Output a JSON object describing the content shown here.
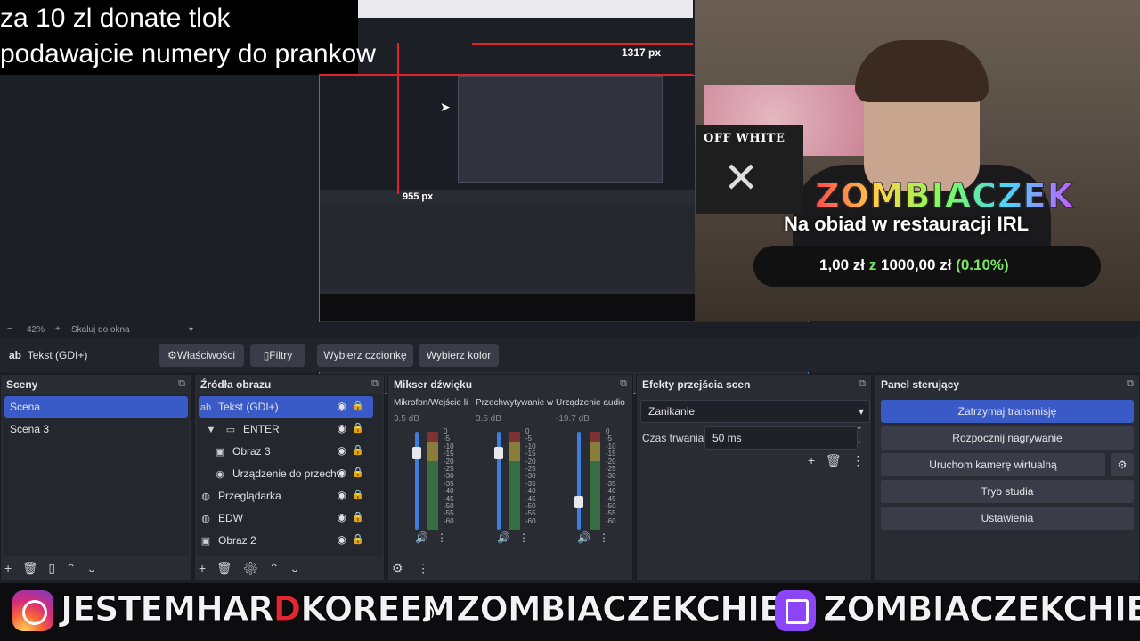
{
  "overlay": {
    "donate_line1": "za 10 zl donate tlok",
    "donate_line2": "podawajcie numery do prankow"
  },
  "preview": {
    "px_label_top": "1317 px",
    "px_label_mid": "955 px",
    "zoom_percent": "42%",
    "zoom_mode": "Skaluj do okna"
  },
  "alert": {
    "off_white": "OFF WHITE",
    "off_white_x": "✕",
    "streamer": "ZOMBIACZEK",
    "goal_title": "Na obiad w restauracji IRL",
    "goal_current": "1,00 zł",
    "goal_sep": "z",
    "goal_target": "1000,00 zł",
    "goal_percent": "(0.10%)"
  },
  "toolbar": {
    "source_icon": "ab",
    "source_name": "Tekst (GDI+)",
    "properties": "Właściwości",
    "filters": "Filtry",
    "choose_font": "Wybierz czcionkę",
    "choose_color": "Wybierz kolor"
  },
  "scenes": {
    "title": "Sceny",
    "items": [
      "Scena",
      "Scena 3"
    ]
  },
  "sources": {
    "title": "Źródła obrazu",
    "items": [
      {
        "icon": "ab",
        "label": "Tekst (GDI+)"
      },
      {
        "icon": "▼",
        "label": "ENTER"
      },
      {
        "icon": "▣",
        "label": "Obraz 3"
      },
      {
        "icon": "◉",
        "label": "Urządzenie do przechw"
      },
      {
        "icon": "◍",
        "label": "Przeglądarka"
      },
      {
        "icon": "◍",
        "label": "EDW"
      },
      {
        "icon": "▣",
        "label": "Obraz 2"
      }
    ]
  },
  "mixer": {
    "title": "Mikser dźwięku",
    "channels": [
      {
        "name": "Mikrofon/Wejście li",
        "db": "3.5 dB",
        "level": 0.78
      },
      {
        "name": "Przechwytywanie w",
        "db": "3.5 dB",
        "level": 0.78
      },
      {
        "name": "Urządzenie audio",
        "db": "-19.7 dB",
        "level": 0.28
      }
    ],
    "scale": [
      "0",
      "-5",
      "-10",
      "-15",
      "-20",
      "-25",
      "-30",
      "-35",
      "-40",
      "-45",
      "-50",
      "-55",
      "-60"
    ]
  },
  "transitions": {
    "title": "Efekty przejścia scen",
    "selected": "Zanikanie",
    "duration_label": "Czas trwania",
    "duration_value": "50 ms"
  },
  "controls": {
    "title": "Panel sterujący",
    "stop_stream": "Zatrzymaj transmisję",
    "start_record": "Rozpocznij nagrywanie",
    "virtual_cam": "Uruchom kamerę wirtualną",
    "studio_mode": "Tryb studia",
    "settings": "Ustawienia"
  },
  "banner": {
    "ig_handle_a": "JESTEMHAR",
    "ig_handle_d": "D",
    "ig_handle_b": "KOREEM",
    "tiktok_handle": "ZOMBIACZEKCHIEF",
    "twitch_handle": "ZOMBIACZEKCHIEF"
  },
  "colors": {
    "accent": "#3a5bc7",
    "goal_green": "#7be36a",
    "bounding_red": "#e0232b"
  }
}
